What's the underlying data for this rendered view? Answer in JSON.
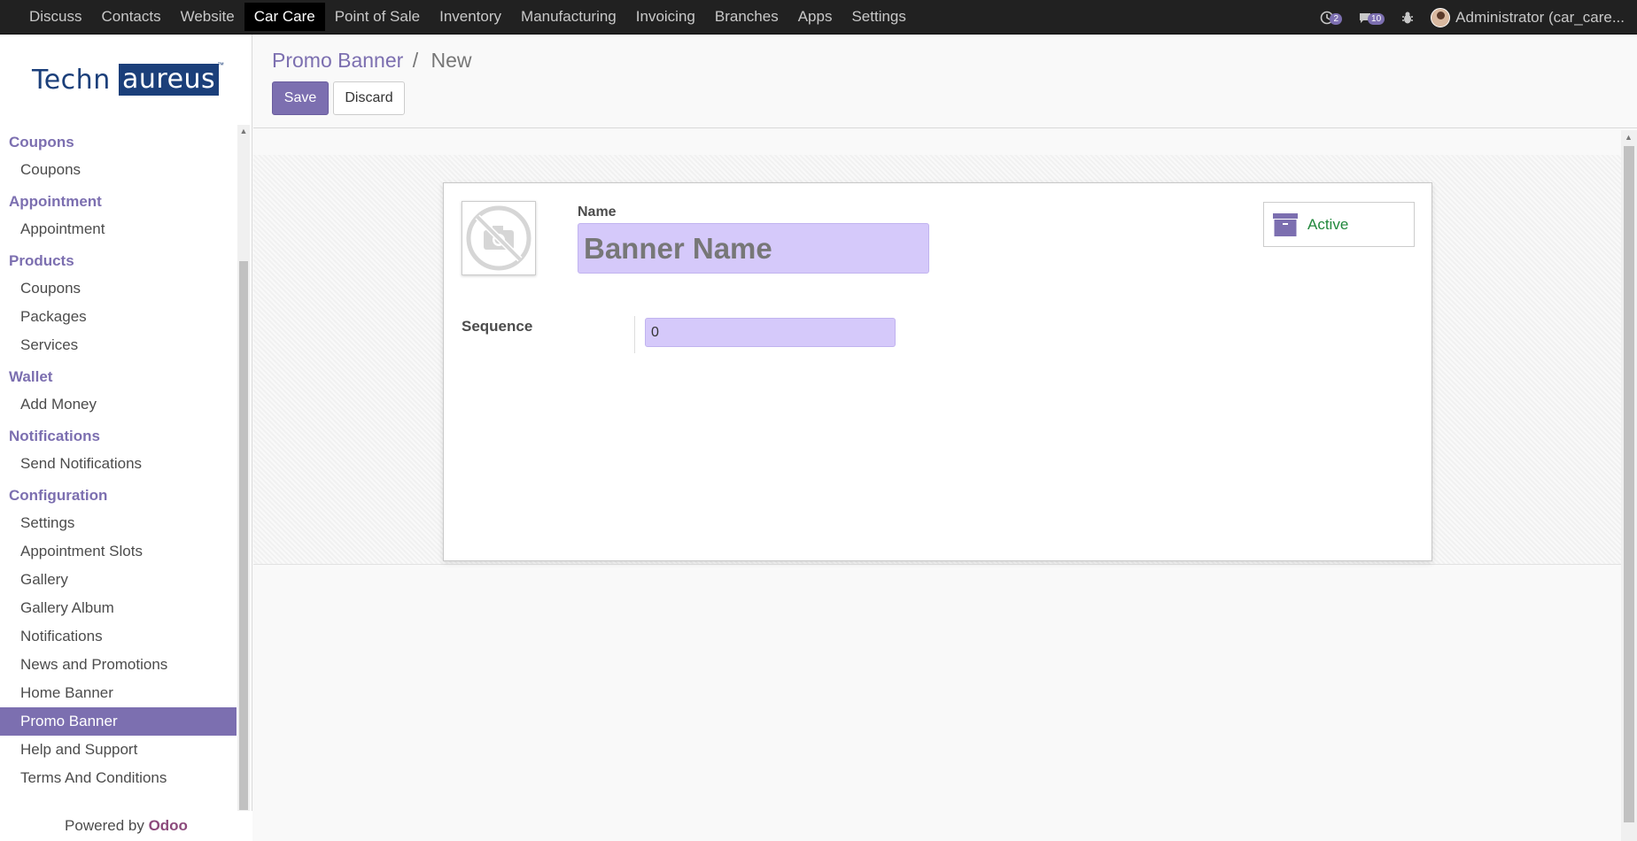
{
  "topbar": {
    "menu": [
      {
        "label": "Discuss",
        "active": false
      },
      {
        "label": "Contacts",
        "active": false
      },
      {
        "label": "Website",
        "active": false
      },
      {
        "label": "Car Care",
        "active": true
      },
      {
        "label": "Point of Sale",
        "active": false
      },
      {
        "label": "Inventory",
        "active": false
      },
      {
        "label": "Manufacturing",
        "active": false
      },
      {
        "label": "Invoicing",
        "active": false
      },
      {
        "label": "Branches",
        "active": false
      },
      {
        "label": "Apps",
        "active": false
      },
      {
        "label": "Settings",
        "active": false
      }
    ],
    "activity_count": "2",
    "messages_count": "10",
    "user_name": "Administrator (car_care..."
  },
  "sidebar": {
    "logo_left": "Techn",
    "logo_right": "aureus",
    "logo_tm": "™",
    "sections": [
      {
        "title": "Coupons",
        "items": [
          {
            "label": "Coupons"
          }
        ]
      },
      {
        "title": "Appointment",
        "items": [
          {
            "label": "Appointment"
          }
        ]
      },
      {
        "title": "Products",
        "items": [
          {
            "label": "Coupons"
          },
          {
            "label": "Packages"
          },
          {
            "label": "Services"
          }
        ]
      },
      {
        "title": "Wallet",
        "items": [
          {
            "label": "Add Money"
          }
        ]
      },
      {
        "title": "Notifications",
        "items": [
          {
            "label": "Send Notifications"
          }
        ]
      },
      {
        "title": "Configuration",
        "items": [
          {
            "label": "Settings"
          },
          {
            "label": "Appointment Slots"
          },
          {
            "label": "Gallery"
          },
          {
            "label": "Gallery Album"
          },
          {
            "label": "Notifications"
          },
          {
            "label": "News and Promotions"
          },
          {
            "label": "Home Banner"
          },
          {
            "label": "Promo Banner",
            "active": true
          },
          {
            "label": "Help and Support"
          },
          {
            "label": "Terms And Conditions"
          }
        ]
      }
    ],
    "powered_by": "Powered by",
    "powered_brand": "Odoo"
  },
  "control_panel": {
    "breadcrumb_parent": "Promo Banner",
    "breadcrumb_separator": "/",
    "breadcrumb_current": "New",
    "save_label": "Save",
    "discard_label": "Discard"
  },
  "form": {
    "name_label": "Name",
    "name_placeholder": "Banner Name",
    "name_value": "",
    "active_label": "Active",
    "sequence_label": "Sequence",
    "sequence_value": "0"
  },
  "colors": {
    "brand": "#7c6fb0",
    "input_bg": "#d5c9fa",
    "topbar_bg": "#212121",
    "active_green": "#21883c"
  }
}
